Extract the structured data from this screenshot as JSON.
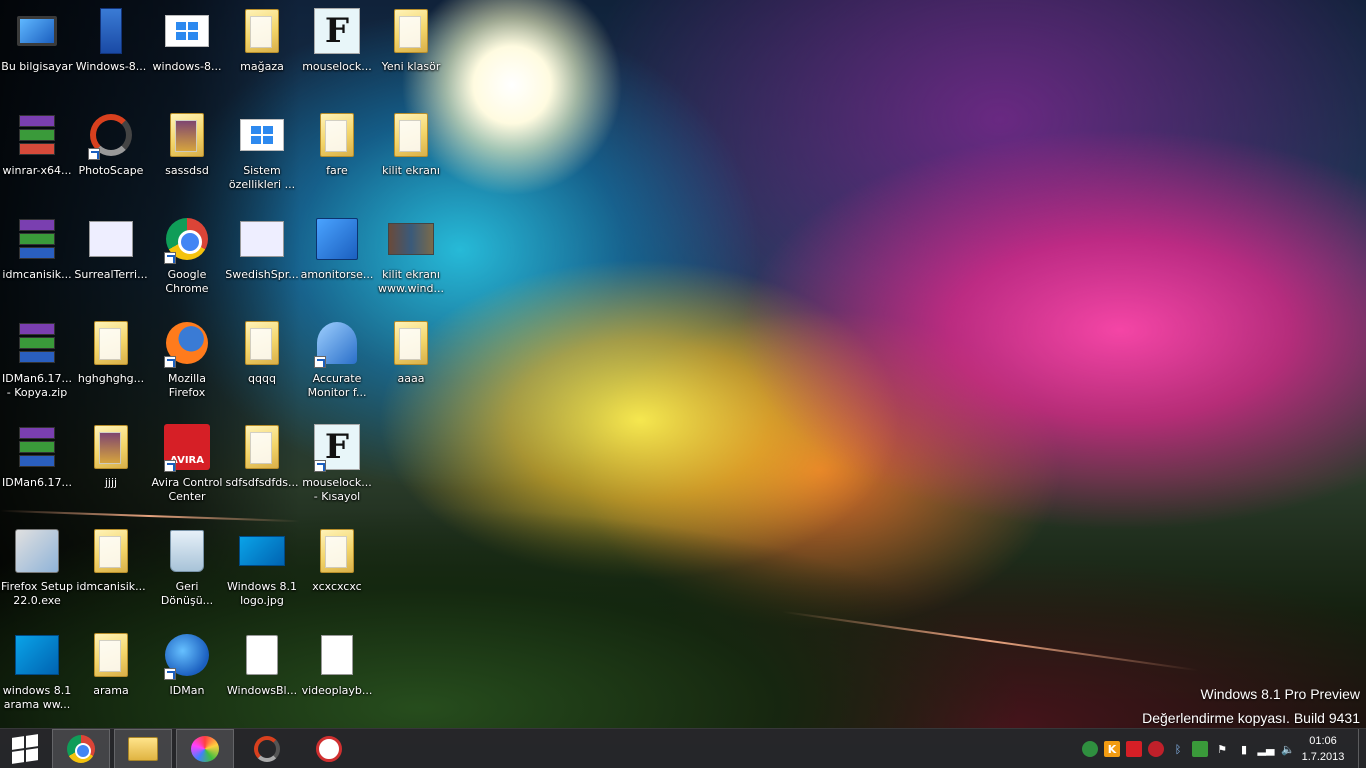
{
  "desktop": {
    "icons": [
      {
        "label": "Bu bilgisayar",
        "icon": "computer-icon"
      },
      {
        "label": "Windows-8...",
        "icon": "phone-document-icon"
      },
      {
        "label": "windows-8...",
        "icon": "windows-logo-icon"
      },
      {
        "label": "mağaza",
        "icon": "folder-icon"
      },
      {
        "label": "mouselock...",
        "icon": "font-file-icon"
      },
      {
        "label": "Yeni klasör",
        "icon": "folder-icon"
      },
      {
        "label": "winrar-x64...",
        "icon": "winrar-installer-icon"
      },
      {
        "label": "PhotoScape",
        "icon": "photoscape-icon"
      },
      {
        "label": "sassdsd",
        "icon": "folder-icon"
      },
      {
        "label": "Sistem özellikleri ...",
        "icon": "windows-logo-icon"
      },
      {
        "label": "fare",
        "icon": "folder-icon"
      },
      {
        "label": "kilit ekranı",
        "icon": "folder-icon"
      },
      {
        "label": "idmcanisik...",
        "icon": "rar-archive-icon"
      },
      {
        "label": "SurrealTerri...",
        "icon": "surreal-app-icon"
      },
      {
        "label": "Google Chrome",
        "icon": "chrome-icon"
      },
      {
        "label": "SwedishSpr...",
        "icon": "surreal-app-icon"
      },
      {
        "label": "amonitorse...",
        "icon": "installer-icon"
      },
      {
        "label": "kilit ekranı www.wind...",
        "icon": "image-thumbnails-icon"
      },
      {
        "label": "IDMan6.17... - Kopya.zip",
        "icon": "rar-archive-icon"
      },
      {
        "label": "hghghghg...",
        "icon": "folder-icon"
      },
      {
        "label": "Mozilla Firefox",
        "icon": "firefox-icon"
      },
      {
        "label": "qqqq",
        "icon": "folder-icon"
      },
      {
        "label": "Accurate Monitor f...",
        "icon": "accurate-monitor-icon"
      },
      {
        "label": "aaaa",
        "icon": "folder-icon"
      },
      {
        "label": "IDMan6.17...",
        "icon": "rar-archive-icon"
      },
      {
        "label": "jjjj",
        "icon": "folder-icon"
      },
      {
        "label": "Avira Control Center",
        "icon": "avira-icon"
      },
      {
        "label": "sdfsdfsdfds...",
        "icon": "folder-icon"
      },
      {
        "label": "mouselock... - Kısayol",
        "icon": "font-file-icon"
      },
      {
        "label": "",
        "icon": ""
      },
      {
        "label": "Firefox Setup 22.0.exe",
        "icon": "setup-icon"
      },
      {
        "label": "idmcanisik...",
        "icon": "folder-icon"
      },
      {
        "label": "Geri Dönüşü...",
        "icon": "recycle-bin-icon"
      },
      {
        "label": "Windows 8.1 logo.jpg",
        "icon": "image-file-icon"
      },
      {
        "label": "xcxcxcxc",
        "icon": "folder-icon"
      },
      {
        "label": "",
        "icon": ""
      },
      {
        "label": "windows 8.1 arama ww...",
        "icon": "image-file-icon"
      },
      {
        "label": "arama",
        "icon": "folder-icon"
      },
      {
        "label": "IDMan",
        "icon": "idm-icon"
      },
      {
        "label": "WindowsBl...",
        "icon": "disc-image-icon"
      },
      {
        "label": "videoplayb...",
        "icon": "blank-document-icon"
      },
      {
        "label": "",
        "icon": ""
      }
    ]
  },
  "watermark": {
    "line1": "Windows 8.1 Pro Preview",
    "line2": "Değerlendirme kopyası. Build 9431"
  },
  "taskbar": {
    "start_label": "Start",
    "apps": [
      {
        "name": "Google Chrome",
        "icon": "chrome-icon"
      },
      {
        "name": "File Explorer",
        "icon": "file-explorer-icon"
      },
      {
        "name": "Paint",
        "icon": "paint-icon"
      },
      {
        "name": "PhotoScape",
        "icon": "photoscape-icon"
      },
      {
        "name": "Snipping Tool",
        "icon": "snipping-tool-icon"
      }
    ],
    "tray_icons": [
      "network-globe-icon",
      "keyboard-k-icon",
      "avira-tray-icon",
      "antivirus-tray-icon",
      "bluetooth-icon",
      "security-shield-icon",
      "flag-icon",
      "battery-icon",
      "signal-icon",
      "volume-icon"
    ],
    "clock": {
      "time": "01:06",
      "date": "1.7.2013"
    }
  },
  "colors": {
    "taskbar": "#28282c",
    "folder": "#f3d56a",
    "accent": "#2d89ef"
  }
}
